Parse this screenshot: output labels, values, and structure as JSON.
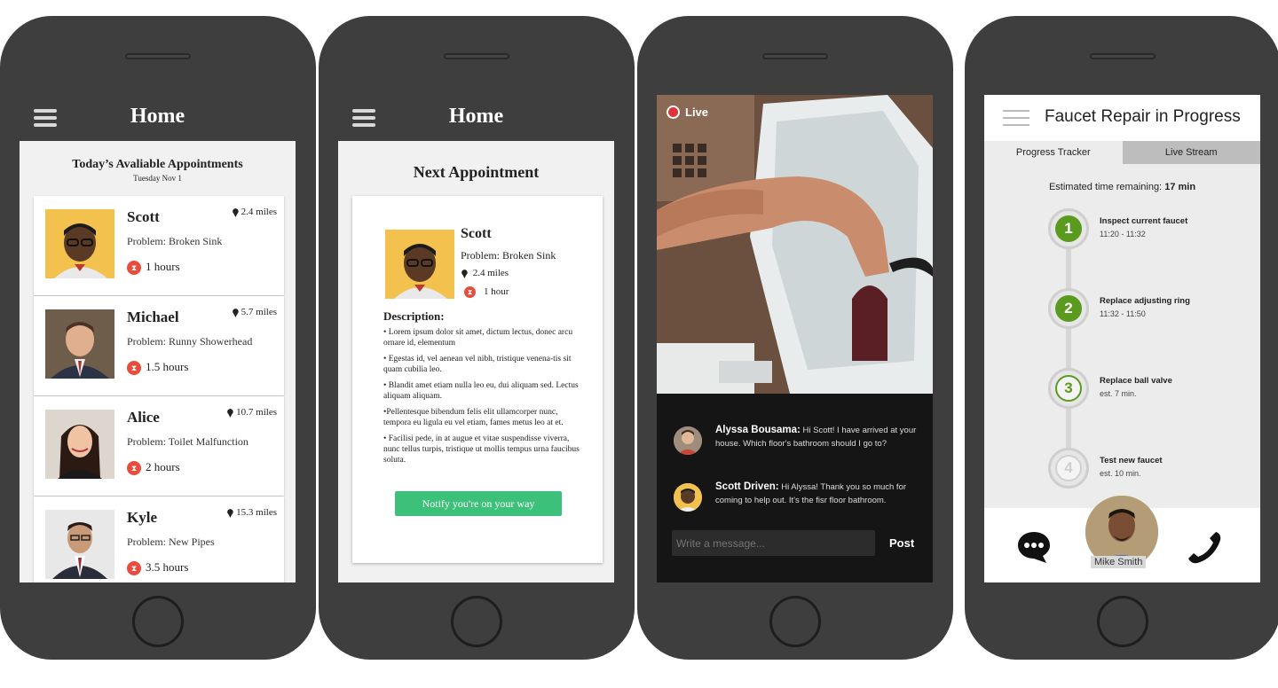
{
  "phone1": {
    "title": "Home",
    "section_title": "Today’s Avaliable Appointments",
    "section_date": "Tuesday Nov 1",
    "appointments": [
      {
        "name": "Scott",
        "distance": "2.4 miles",
        "problem": "Problem: Broken Sink",
        "duration": "1 hours"
      },
      {
        "name": "Michael",
        "distance": "5.7 miles",
        "problem": "Problem: Runny Showerhead",
        "duration": "1.5 hours"
      },
      {
        "name": "Alice",
        "distance": "10.7 miles",
        "problem": "Problem: Toilet Malfunction",
        "duration": "2 hours"
      },
      {
        "name": "Kyle",
        "distance": "15.3 miles",
        "problem": "Problem: New Pipes",
        "duration": "3.5 hours"
      }
    ]
  },
  "phone2": {
    "title": "Home",
    "section_title": "Next Appointment",
    "name": "Scott",
    "problem": "Problem: Broken Sink",
    "distance": "2.4 miles",
    "duration": "1 hour",
    "description_label": "Description:",
    "description": [
      "• Lorem ipsum dolor sit amet, dictum lectus, donec arcu ornare id, elementum",
      "• Egestas id, vel aenean vel nibh, tristique venena-tis sit quam cubilia leo.",
      "• Blandit amet etiam nulla leo eu, dui aliquam sed. Lectus aliquam aliquam.",
      "•Pellentesque bibendum felis elit ullamcorper nunc, tempora eu ligula eu vel etiam, fames metus leo at et.",
      "• Facilisi pede, in at augue et vitae suspendisse viverra, nunc tellus turpis, tristique ut mollis tempus urna faucibus soluta."
    ],
    "button_label": "Notify you're on your way",
    "accent_color": "#3cc07a"
  },
  "phone3": {
    "live_label": "Live",
    "messages": [
      {
        "author": "Alyssa Bousama:",
        "text": "Hi Scott! I have arrived at your house. Which floor's bathroom should I go to?"
      },
      {
        "author": "Scott Driven:",
        "text": "Hi Alyssa! Thank you so much for coming to help out. It's the fisr floor bathroom."
      }
    ],
    "input_placeholder": "Write a message...",
    "post_label": "Post"
  },
  "phone4": {
    "title": "Faucet Repair in Progress",
    "tabs": [
      "Progress Tracker",
      "Live Stream"
    ],
    "estimate_label": "Estimated time remaining:",
    "estimate_value": "17 min",
    "steps": [
      {
        "number": "1",
        "title": "Inspect current faucet",
        "time": "11:20 - 11:32"
      },
      {
        "number": "2",
        "title": "Replace adjusting ring",
        "time": "11:32 - 11:50"
      },
      {
        "number": "3",
        "title": "Replace ball valve",
        "time": "est. 7 min."
      },
      {
        "number": "4",
        "title": "Test new faucet",
        "time": "est. 10 min."
      }
    ],
    "contact_name": "Mike Smith",
    "chat_icon": "chat-bubble-icon",
    "phone_icon": "phone-icon"
  }
}
